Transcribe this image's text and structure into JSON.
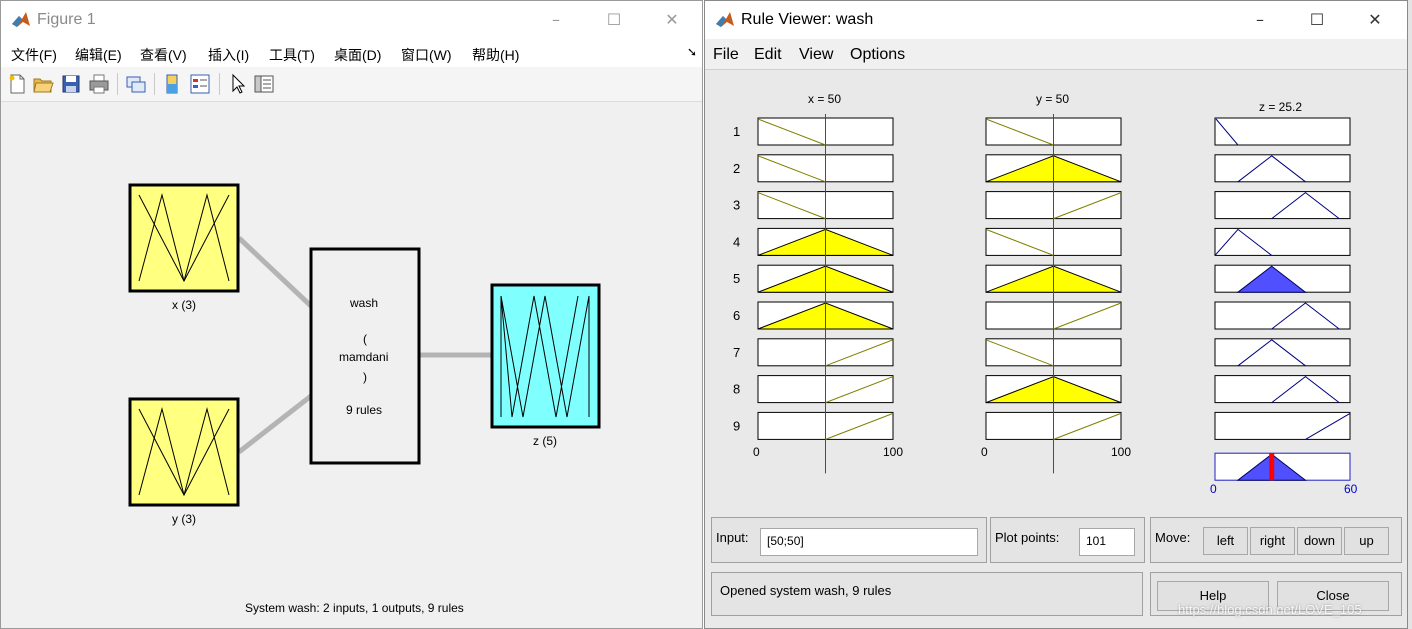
{
  "figure": {
    "title": "Figure 1",
    "menu": [
      "文件(F)",
      "编辑(E)",
      "查看(V)",
      "插入(I)",
      "工具(T)",
      "桌面(D)",
      "窗口(W)",
      "帮助(H)"
    ],
    "nodes": {
      "x_label": "x (3)",
      "y_label": "y (3)",
      "z_label": "z (5)",
      "system_name": "wash",
      "paren_open": "(",
      "method": "mamdani",
      "paren_close": ")",
      "rules": "9 rules"
    },
    "status": "System wash: 2 inputs, 1 outputs, 9 rules",
    "colors": {
      "input": "#ffff80",
      "output": "#80ffff"
    }
  },
  "rule_viewer": {
    "title": "Rule Viewer: wash",
    "menu": [
      "File",
      "Edit",
      "View",
      "Options"
    ],
    "columns": {
      "x_header": "x = 50",
      "y_header": "y = 50",
      "z_header": "z = 25.2",
      "x_min": "0",
      "x_max": "100",
      "y_min": "0",
      "y_max": "100",
      "z_min": "0",
      "z_max": "60"
    },
    "rule_numbers": [
      "1",
      "2",
      "3",
      "4",
      "5",
      "6",
      "7",
      "8",
      "9"
    ],
    "input_label": "Input:",
    "input_value": "[50;50]",
    "plot_points_label": "Plot points:",
    "plot_points_value": "101",
    "move_label": "Move:",
    "move_buttons": {
      "left": "left",
      "right": "right",
      "down": "down",
      "up": "up"
    },
    "status": "Opened system wash, 9 rules",
    "help": "Help",
    "close": "Close",
    "colors": {
      "fired": "#ffff00",
      "output_fire": "#5050ff",
      "cursor": "#ff0000",
      "mf_line": "#808000"
    }
  },
  "watermark": "https://blog.csdn.net/LOVE_105"
}
